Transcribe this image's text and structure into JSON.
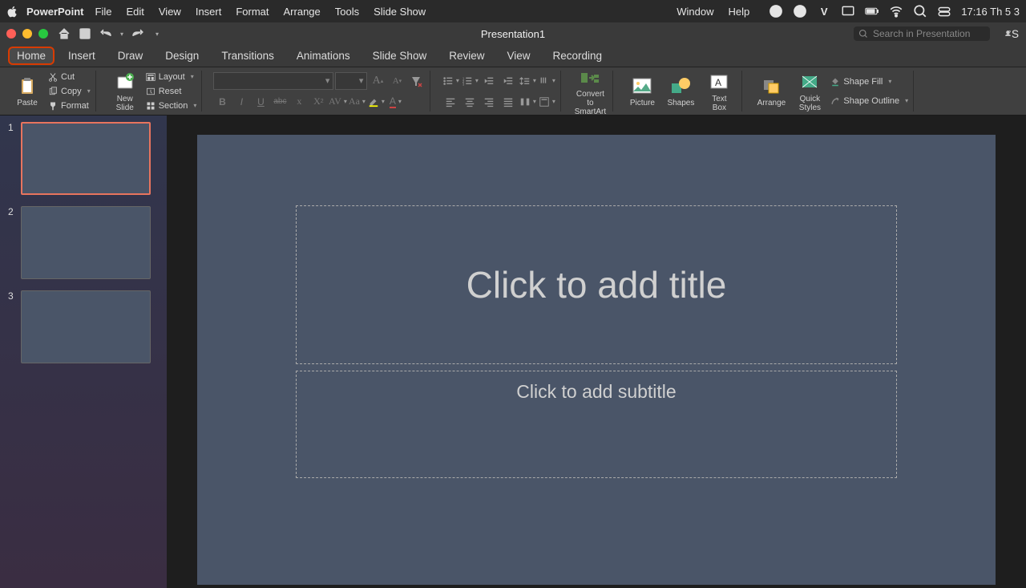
{
  "menubar": {
    "app_name": "PowerPoint",
    "items": [
      "File",
      "Edit",
      "View",
      "Insert",
      "Format",
      "Arrange",
      "Tools",
      "Slide Show",
      "Window",
      "Help"
    ],
    "clock": "17:16 Th 5 3"
  },
  "titlebar": {
    "doc_title": "Presentation1",
    "search_placeholder": "Search in Presentation",
    "share_label": "S"
  },
  "ribbon_tabs": [
    "Home",
    "Insert",
    "Draw",
    "Design",
    "Transitions",
    "Animations",
    "Slide Show",
    "Review",
    "View",
    "Recording"
  ],
  "ribbon": {
    "paste": "Paste",
    "cut": "Cut",
    "copy": "Copy",
    "format": "Format",
    "new_slide": "New\nSlide",
    "layout": "Layout",
    "reset": "Reset",
    "section": "Section",
    "convert_smartart": "Convert to\nSmartArt",
    "picture": "Picture",
    "shapes": "Shapes",
    "textbox": "Text\nBox",
    "arrange": "Arrange",
    "quick_styles": "Quick\nStyles",
    "shape_fill": "Shape Fill",
    "shape_outline": "Shape Outline"
  },
  "slides": [
    {
      "num": "1",
      "selected": true
    },
    {
      "num": "2",
      "selected": false
    },
    {
      "num": "3",
      "selected": false
    }
  ],
  "canvas": {
    "title_placeholder": "Click to add title",
    "subtitle_placeholder": "Click to add subtitle"
  }
}
